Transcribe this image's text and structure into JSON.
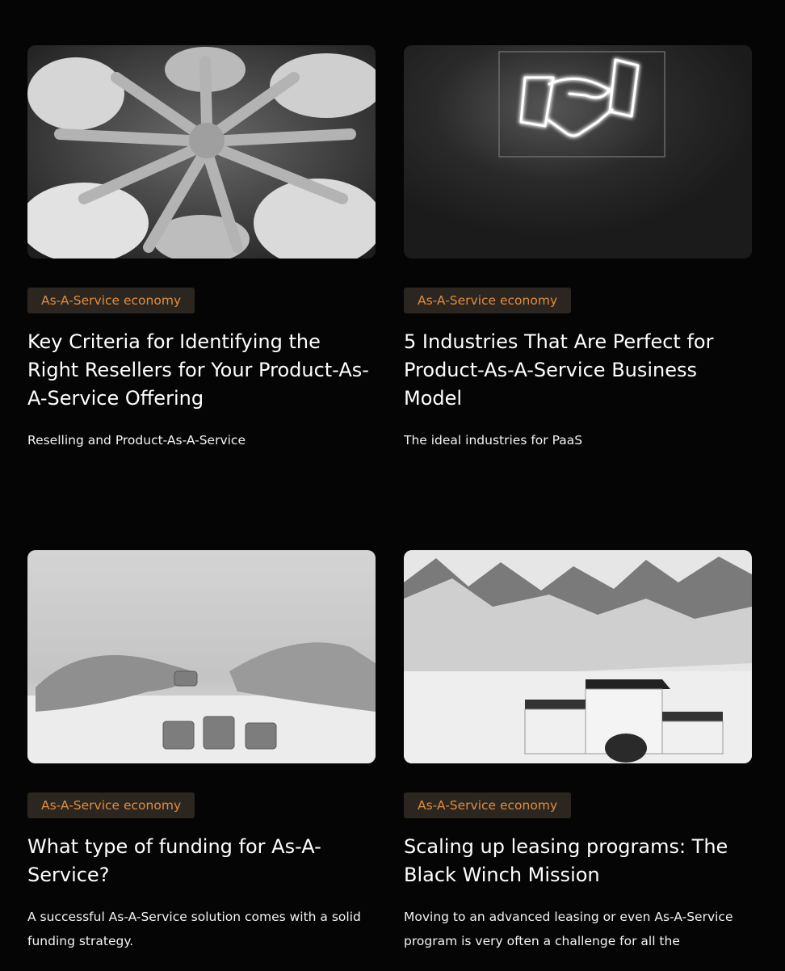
{
  "articles": [
    {
      "image": "team-hands-photo",
      "tag": "As-A-Service economy",
      "title": "Key Criteria for Identifying the Right Resellers for Your Product-As-A-Service Offering",
      "description": "Reselling and Product-As-A-Service"
    },
    {
      "image": "neon-handshake-photo",
      "tag": "As-A-Service economy",
      "title": "5 Industries That Are Perfect for Product-As-A-Service Business Model",
      "description": "The ideal industries for PaaS"
    },
    {
      "image": "coin-stacks-photo",
      "tag": "As-A-Service economy",
      "title": "What type of funding for As-A-Service?",
      "description": "A successful As-A-Service solution comes with a solid funding strategy."
    },
    {
      "image": "mountain-podium-photo",
      "tag": "As-A-Service economy",
      "title": "Scaling up leasing programs: The Black Winch Mission",
      "description": "Moving to an advanced leasing or even As-A-Service program is very often a challenge for all the"
    }
  ],
  "colors": {
    "background": "#060505",
    "tag_background": "#2b2620",
    "tag_text": "#e08c3c",
    "text": "#ffffff"
  }
}
